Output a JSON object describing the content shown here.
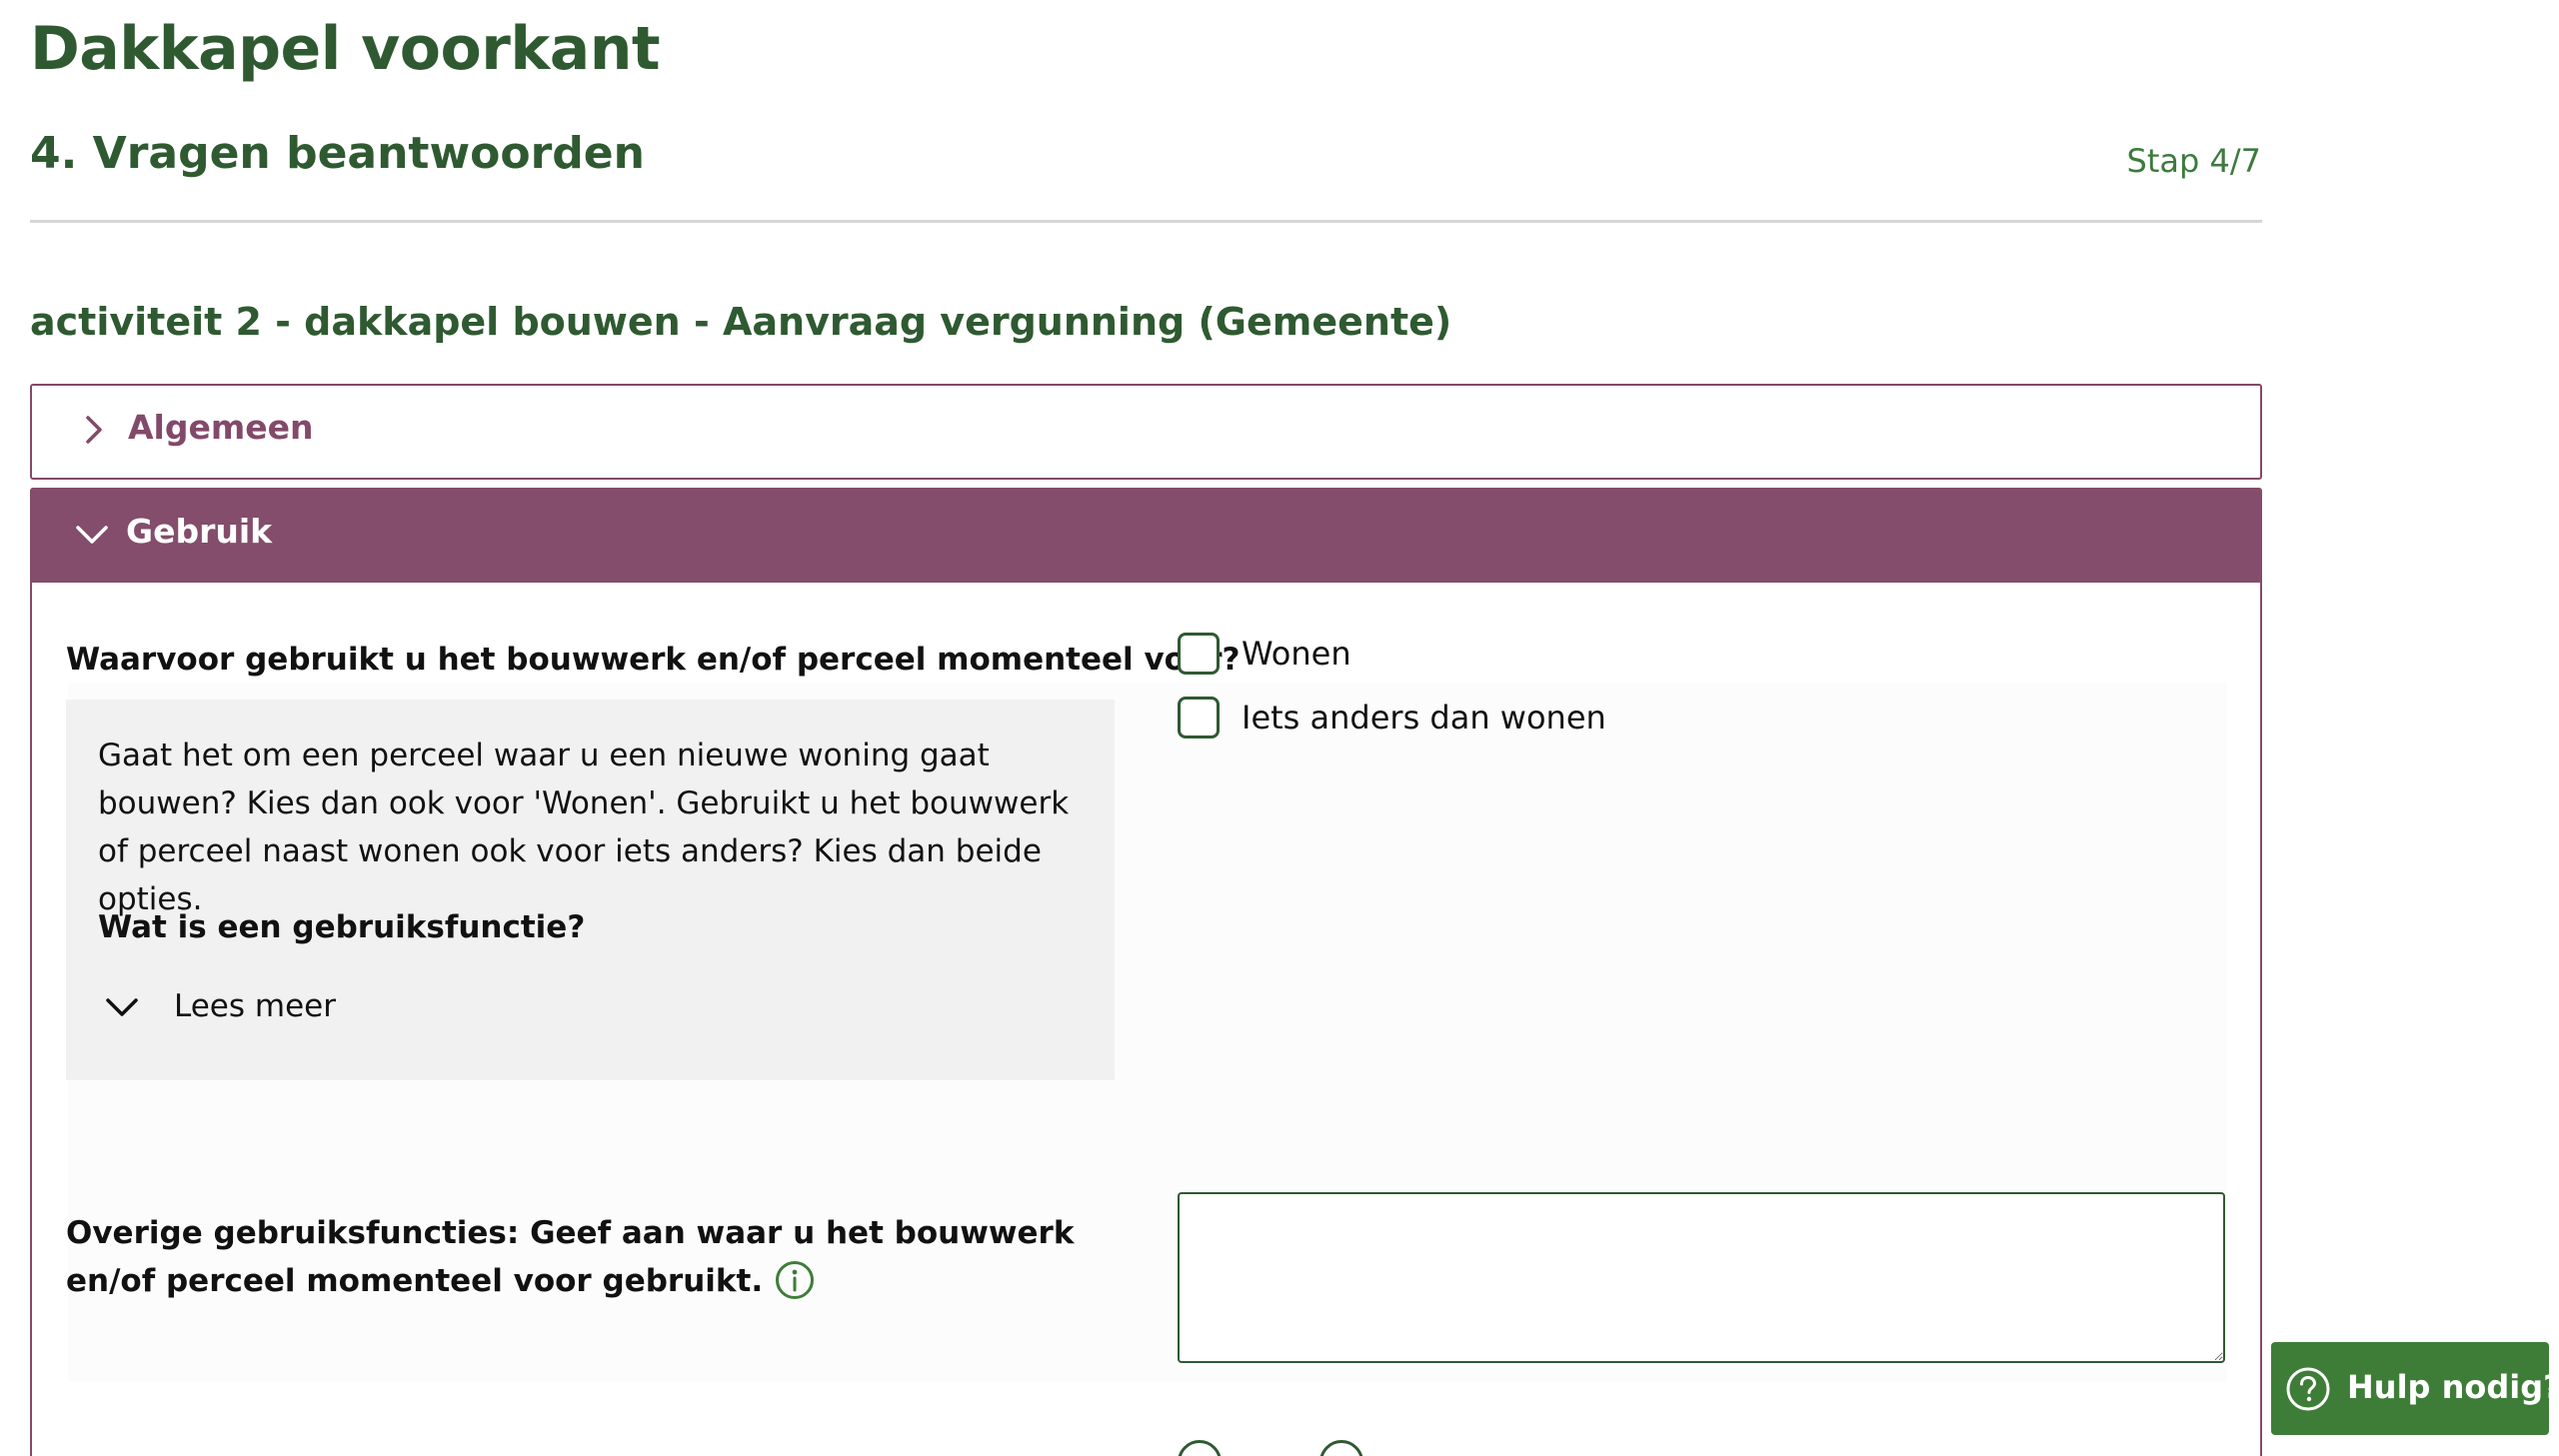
{
  "page": {
    "title": "Dakkapel voorkant",
    "step_title": "4. Vragen beantwoorden",
    "step_indicator": "Stap 4/7"
  },
  "section": {
    "title": "activiteit 2 - dakkapel bouwen - Aanvraag vergunning (Gemeente)"
  },
  "accordions": [
    {
      "label": "Algemeen",
      "expanded": false
    },
    {
      "label": "Gebruik",
      "expanded": true
    }
  ],
  "question_1": {
    "label": "Waarvoor gebruikt u het bouwwerk en/of perceel momenteel voor?",
    "help_text": "Gaat het om een perceel waar u een nieuwe woning gaat bouwen? Kies dan ook voor 'Wonen'. Gebruikt u het bouwwerk of perceel naast wonen ook voor iets anders? Kies dan beide opties.",
    "help_subtitle": "Wat is een gebruiksfunctie?",
    "read_more_label": "Lees meer",
    "options": [
      {
        "label": "Wonen",
        "checked": false
      },
      {
        "label": "Iets anders dan wonen",
        "checked": false
      }
    ]
  },
  "question_2": {
    "label": "Overige gebruiksfuncties: Geef aan waar u het bouwwerk en/of perceel momenteel voor gebruikt.",
    "value": ""
  },
  "help_button": {
    "label": "Hulp nodig?"
  },
  "colors": {
    "heading_green": "#2f5a31",
    "accent_purple": "#834d6b",
    "button_green": "#3e7d37"
  },
  "icons": {
    "collapsed": "chevron-right-icon",
    "expanded": "chevron-down-icon",
    "info": "info-icon",
    "help": "question-circle-icon"
  }
}
